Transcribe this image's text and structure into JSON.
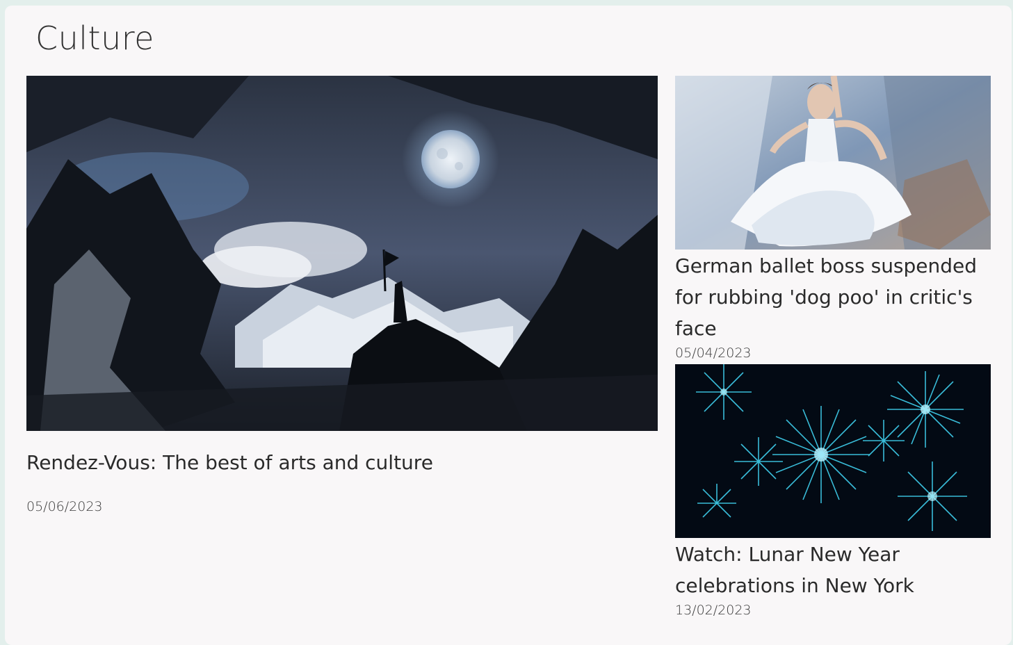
{
  "section": {
    "title": "Culture"
  },
  "feature": {
    "title": "Rendez-Vous: The best of arts and culture",
    "date": "05/06/2023",
    "image_icon": "moonlit-mountains-image"
  },
  "side_articles": [
    {
      "title": "German ballet boss suspended for rubbing 'dog poo' in critic's face",
      "date": "05/04/2023",
      "image_icon": "ballerina-painting-image"
    },
    {
      "title": "Watch: Lunar New Year celebrations in New York",
      "date": "13/02/2023",
      "image_icon": "fireworks-image"
    }
  ],
  "colors": {
    "page_background": "#e3efec",
    "panel_background": "#f9f7f8",
    "text": "#2a2a2a"
  }
}
